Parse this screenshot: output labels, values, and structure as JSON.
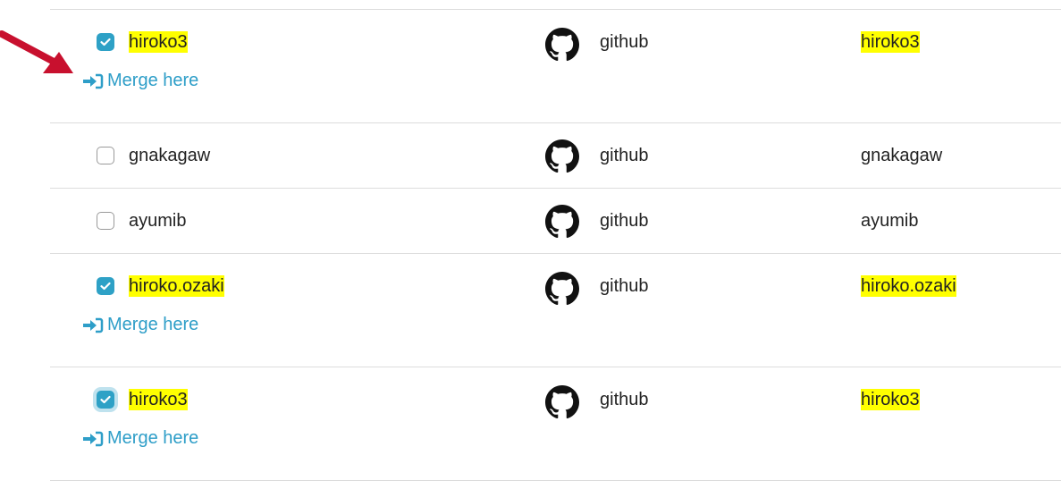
{
  "rows": [
    {
      "username": "hiroko3",
      "checked": true,
      "highlight": true,
      "provider": "github",
      "external": "hiroko3",
      "merge": "Merge here"
    },
    {
      "username": "gnakagaw",
      "checked": false,
      "highlight": false,
      "provider": "github",
      "external": "gnakagaw"
    },
    {
      "username": "ayumib",
      "checked": false,
      "highlight": false,
      "provider": "github",
      "external": "ayumib"
    },
    {
      "username": "hiroko.ozaki",
      "checked": true,
      "highlight": true,
      "provider": "github",
      "external": "hiroko.ozaki",
      "merge": "Merge here"
    },
    {
      "username": "hiroko3",
      "checked": true,
      "highlight": true,
      "focused": true,
      "provider": "github",
      "external": "hiroko3",
      "merge": "Merge here"
    }
  ],
  "colors": {
    "accent": "#2ea1c6",
    "highlight": "#ffff00",
    "arrow": "#c8102e"
  },
  "icons": [
    "checkbox-icon",
    "github-icon",
    "sign-in-icon",
    "red-arrow-annotation"
  ]
}
